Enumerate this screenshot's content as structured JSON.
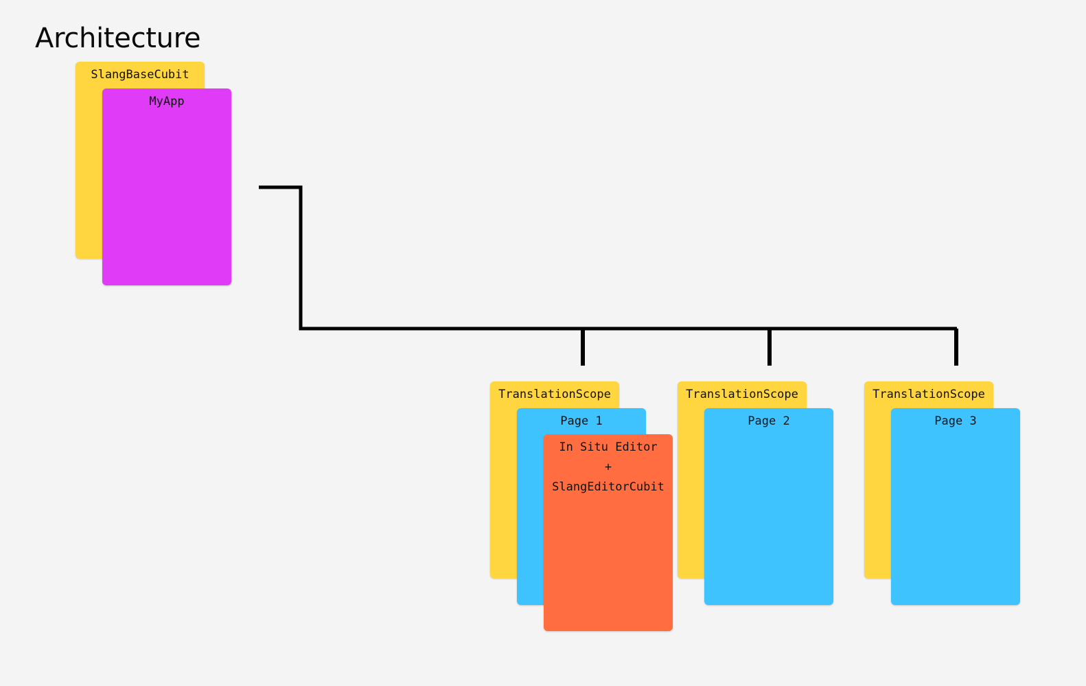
{
  "title": "Architecture",
  "colors": {
    "yellow": "#ffd640",
    "magenta": "#e03cf8",
    "blue": "#3fc3ff",
    "orange": "#ff6d41",
    "line": "#000000",
    "background": "#f4f4f4"
  },
  "root": {
    "base_label": "SlangBaseCubit",
    "app_label": "MyApp"
  },
  "scopes": [
    {
      "scope_label": "TranslationScope",
      "page_label": "Page 1"
    },
    {
      "scope_label": "TranslationScope",
      "page_label": "Page 2"
    },
    {
      "scope_label": "TranslationScope",
      "page_label": "Page 3"
    }
  ],
  "editor": {
    "line1": "In Situ Editor",
    "line2": "+",
    "line3": "SlangEditorCubit"
  }
}
